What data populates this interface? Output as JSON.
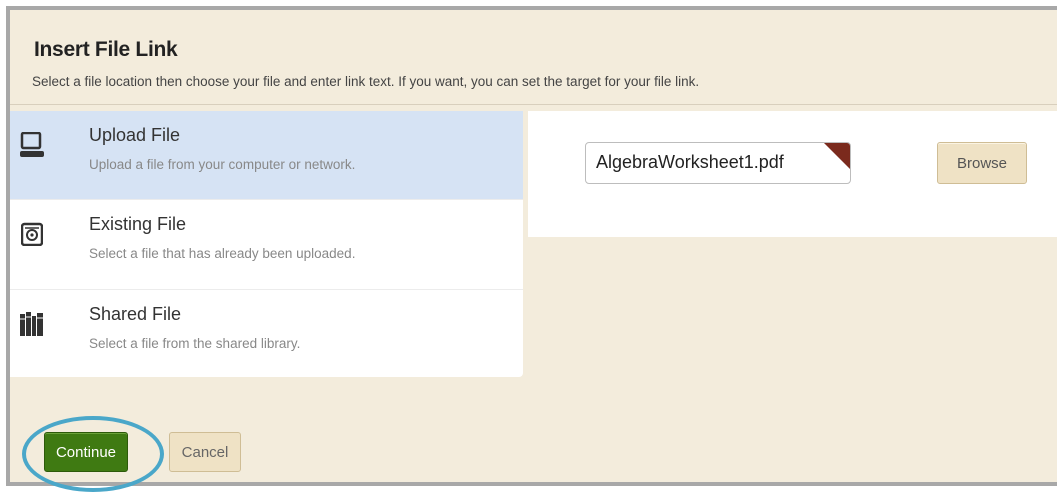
{
  "dialog": {
    "title": "Insert File Link",
    "subtitle": "Select a file location then choose your file and enter link text. If you want, you can set the target for your file link."
  },
  "locations": [
    {
      "name": "Upload File",
      "description": "Upload a file from your computer or network.",
      "icon": "laptop-icon",
      "selected": true
    },
    {
      "name": "Existing File",
      "description": "Select a file that has already been uploaded.",
      "icon": "disk-icon",
      "selected": false
    },
    {
      "name": "Shared File",
      "description": "Select a file from the shared library.",
      "icon": "library-books-icon",
      "selected": false
    }
  ],
  "upload": {
    "file_value": "AlgebraWorksheet1.pdf",
    "browse_label": "Browse"
  },
  "footer": {
    "continue_label": "Continue",
    "cancel_label": "Cancel"
  },
  "colors": {
    "dialog_bg": "#f3ecdc",
    "selected_bg": "#d6e3f4",
    "continue_bg": "#3f7a12",
    "highlight_ring": "#4aa7c9",
    "corner_accent": "#7b2a1d"
  }
}
